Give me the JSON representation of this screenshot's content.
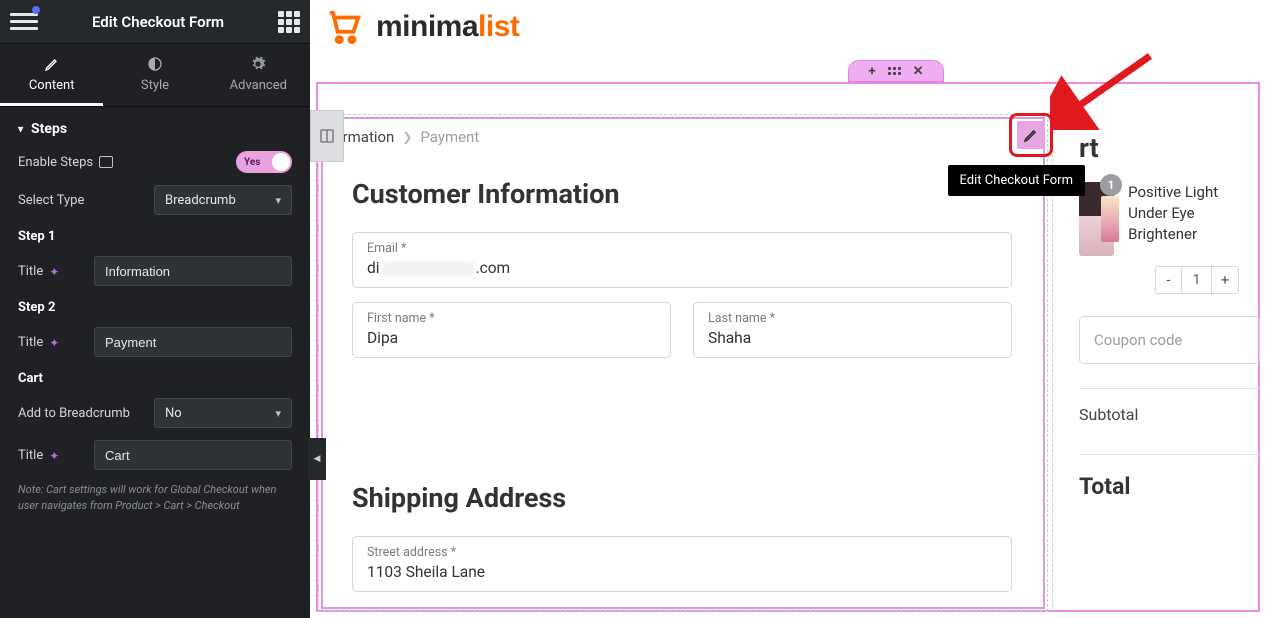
{
  "sidebar": {
    "header_title": "Edit Checkout Form",
    "tabs": {
      "content": "Content",
      "style": "Style",
      "advanced": "Advanced"
    },
    "panel_heading": "Steps",
    "enable_steps_label": "Enable Steps",
    "enable_steps_value": "Yes",
    "select_type_label": "Select Type",
    "select_type_value": "Breadcrumb",
    "step1_heading": "Step 1",
    "step1_title_label": "Title",
    "step1_title_value": "Information",
    "step2_heading": "Step 2",
    "step2_title_label": "Title",
    "step2_title_value": "Payment",
    "cart_heading": "Cart",
    "add_bc_label": "Add to Breadcrumb",
    "add_bc_value": "No",
    "cart_title_label": "Title",
    "cart_title_value": "Cart",
    "note": "Note: Cart settings will work for Global Checkout when user navigates from Product > Cart > Checkout"
  },
  "logo": {
    "part1": "minima",
    "part2": "list"
  },
  "tooltip": "Edit Checkout Form",
  "breadcrumb": {
    "step1_partial": "ormation",
    "step2": "Payment"
  },
  "form": {
    "heading1": "Customer Information",
    "email_label": "Email *",
    "email_value_prefix": "di",
    "email_value_suffix": ".com",
    "first_label": "First name *",
    "first_value": "Dipa",
    "last_label": "Last name *",
    "last_value": "Shaha",
    "heading2": "Shipping Address",
    "street_label": "Street address *",
    "street_value": "1103 Sheila Lane"
  },
  "cart": {
    "heading_partial": "rt",
    "badge": "1",
    "product": "Positive Light Under Eye Brightener",
    "qty_minus": "-",
    "qty_val": "1",
    "qty_plus": "+",
    "coupon_placeholder": "Coupon code",
    "subtotal_label": "Subtotal",
    "total_label": "Total"
  }
}
